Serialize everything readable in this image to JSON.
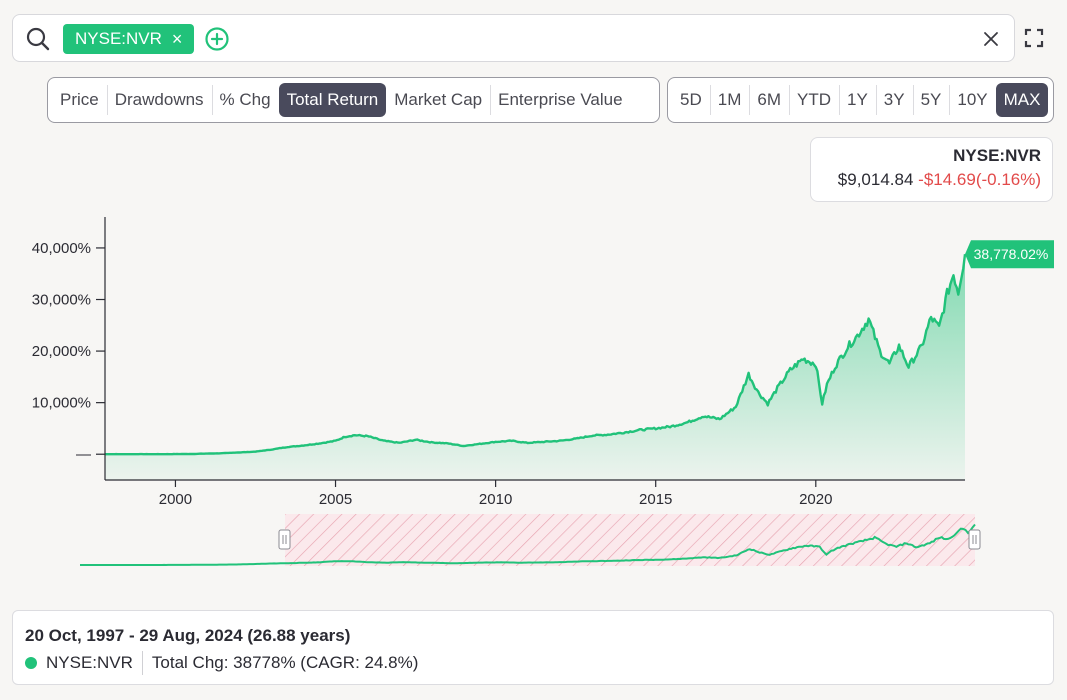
{
  "search": {
    "ticker_chip": "NYSE:NVR",
    "chip_close": "×"
  },
  "metric_tabs": [
    "Price",
    "Drawdowns",
    "% Chg",
    "Total Return",
    "Market Cap",
    "Enterprise Value"
  ],
  "active_metric": "Total Return",
  "range_tabs": [
    "5D",
    "1M",
    "6M",
    "YTD",
    "1Y",
    "3Y",
    "5Y",
    "10Y",
    "MAX"
  ],
  "active_range": "MAX",
  "quote": {
    "symbol": "NYSE:NVR",
    "price": "$9,014.84",
    "change": "-$14.69(-0.16%)"
  },
  "colors": {
    "accent": "#21c27a",
    "negative": "#e24a4a",
    "active_tab": "#494a5c"
  },
  "chart_data": {
    "type": "area",
    "series": [
      {
        "name": "NYSE:NVR",
        "x": [
          1997.8,
          1998.5,
          1999.5,
          2000.5,
          2001.5,
          2002.5,
          2003.0,
          2003.5,
          2004.0,
          2004.5,
          2005.0,
          2005.3,
          2005.6,
          2006.0,
          2006.5,
          2007.0,
          2007.5,
          2008.0,
          2008.5,
          2009.0,
          2009.5,
          2010.0,
          2010.5,
          2011.0,
          2011.5,
          2012.0,
          2012.5,
          2013.0,
          2013.5,
          2014.0,
          2014.5,
          2015.0,
          2015.5,
          2016.0,
          2016.5,
          2017.0,
          2017.5,
          2017.9,
          2018.2,
          2018.5,
          2018.8,
          2019.2,
          2019.6,
          2020.0,
          2020.2,
          2020.35,
          2020.6,
          2021.0,
          2021.3,
          2021.65,
          2022.0,
          2022.3,
          2022.6,
          2022.9,
          2023.3,
          2023.6,
          2023.85,
          2024.1,
          2024.3,
          2024.45,
          2024.66
        ],
        "y": [
          0,
          0,
          0,
          50,
          200,
          500,
          900,
          1400,
          1700,
          2100,
          2600,
          3400,
          3700,
          3500,
          2600,
          2200,
          2800,
          2300,
          2100,
          1600,
          2000,
          2400,
          2600,
          2200,
          2400,
          2600,
          3000,
          3600,
          3800,
          4200,
          4700,
          5000,
          5400,
          6200,
          7400,
          6800,
          9200,
          15500,
          12000,
          9800,
          12800,
          16300,
          18500,
          17500,
          9800,
          13500,
          17000,
          20800,
          23000,
          26200,
          20000,
          17500,
          21000,
          17000,
          20800,
          26500,
          24500,
          31000,
          35000,
          31500,
          38778
        ]
      }
    ],
    "y_ticks": [
      "40,000%",
      "30,000%",
      "20,000%",
      "10,000%",
      "—"
    ],
    "y_tick_values": [
      40000,
      30000,
      20000,
      10000,
      0
    ],
    "x_ticks": [
      "2000",
      "2005",
      "2010",
      "2015",
      "2020"
    ],
    "x_tick_values": [
      2000,
      2005,
      2010,
      2015,
      2020
    ],
    "xlim": [
      1997.8,
      2024.66
    ],
    "ylim": [
      -5000,
      46000
    ],
    "end_value_label": "38,778.02%",
    "grid": false
  },
  "footer": {
    "date_range": "20 Oct, 1997 - 29 Aug, 2024 (26.88 years)",
    "series_name": "NYSE:NVR",
    "summary": "Total Chg: 38778% (CAGR: 24.8%)"
  }
}
